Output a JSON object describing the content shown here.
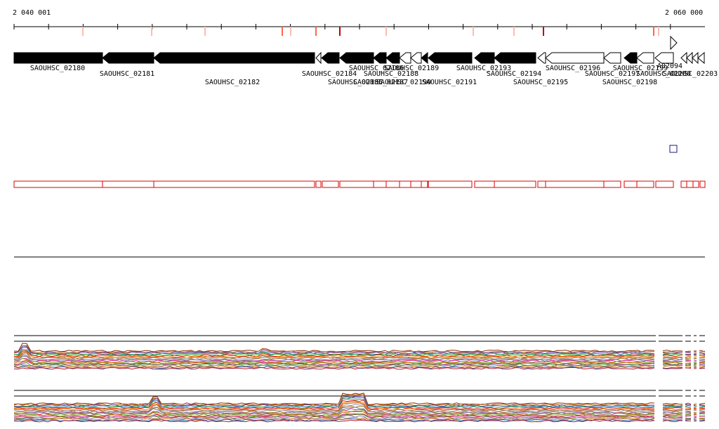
{
  "axis": {
    "start_label": "2 040 001",
    "end_label": "2 060 000"
  },
  "colors": {
    "gene_filled": "#000000",
    "gene_open": "#ffffff",
    "feature_box": "#dd0000",
    "mark_dark": "#bb0000",
    "mark_mid": "#ff6644",
    "mark_light": "#ffbbaa",
    "marker_square": "#1a1a80"
  },
  "genes": [
    {
      "label": "SAOUHSC_02180",
      "filled": true
    },
    {
      "label": "SAOUHSC_02181",
      "filled": true
    },
    {
      "label": "SAOUHSC_02182",
      "filled": true
    },
    {
      "label": "SAOUHSC_02184",
      "filled": false
    },
    {
      "label": "SAOUHSC_02185",
      "filled": true
    },
    {
      "label": "SAOUHSC_02186",
      "filled": true
    },
    {
      "label": "SAOUHSC_02187",
      "filled": true
    },
    {
      "label": "SAOUHSC_02188",
      "filled": true
    },
    {
      "label": "SAOUHSC_02189",
      "filled": false
    },
    {
      "label": "SAOUHSC_02190",
      "filled": false
    },
    {
      "label": "SAOUHSC_02191",
      "filled": true
    },
    {
      "label": "SAOUHSC_02193",
      "filled": true
    },
    {
      "label": "SAOUHSC_02194",
      "filled": true
    },
    {
      "label": "SAOUHSC_02195",
      "filled": true
    },
    {
      "label": "SAOUHSC_02196",
      "filled": false
    },
    {
      "label": "SAOUHSC_02197",
      "filled": false
    },
    {
      "label": "SAOUHSC_02198",
      "filled": false
    },
    {
      "label": "SAOUHSC_02199",
      "filled": true
    },
    {
      "label": "SAOUHSC_02200",
      "filled": false
    },
    {
      "label": "A02094",
      "filled": false
    },
    {
      "label": "SAOUHSC_02203",
      "filled": false
    }
  ]
}
